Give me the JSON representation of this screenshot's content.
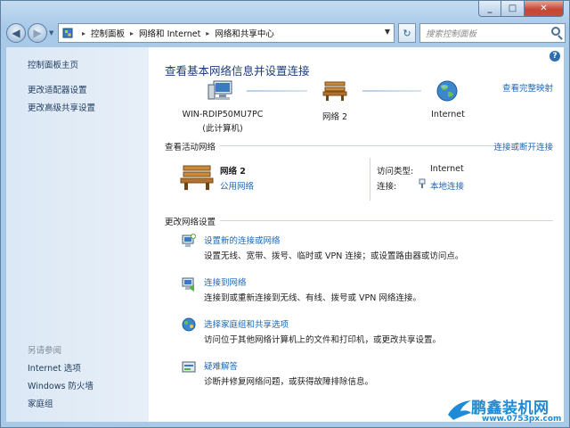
{
  "address": {
    "crumbs": [
      "控制面板",
      "网络和 Internet",
      "网络和共享中心"
    ]
  },
  "search": {
    "placeholder": "搜索控制面板"
  },
  "sidebar": {
    "links": [
      "控制面板主页",
      "更改适配器设置",
      "更改高级共享设置"
    ],
    "see_also_title": "另请参阅",
    "see_also": [
      "Internet 选项",
      "Windows 防火墙",
      "家庭组"
    ]
  },
  "main": {
    "title": "查看基本网络信息并设置连接",
    "full_map_link": "查看完整映射",
    "map": {
      "computer_name": "WIN-RDIP50MU7PC",
      "computer_sub": "(此计算机)",
      "network": "网络  2",
      "internet": "Internet"
    },
    "active": {
      "heading": "查看活动网络",
      "connect_link": "连接或断开连接",
      "name": "网络  2",
      "type": "公用网络",
      "access_label": "访问类型:",
      "access_value": "Internet",
      "conn_label": "连接:",
      "conn_value": "本地连接"
    },
    "change": {
      "heading": "更改网络设置",
      "tasks": [
        {
          "title": "设置新的连接或网络",
          "desc": "设置无线、宽带、拨号、临时或 VPN 连接；或设置路由器或访问点。"
        },
        {
          "title": "连接到网络",
          "desc": "连接到或重新连接到无线、有线、拨号或 VPN 网络连接。"
        },
        {
          "title": "选择家庭组和共享选项",
          "desc": "访问位于其他网络计算机上的文件和打印机，或更改共享设置。"
        },
        {
          "title": "疑难解答",
          "desc": "诊断并修复网络问题，或获得故障排除信息。"
        }
      ]
    }
  },
  "watermark": {
    "brand": "鹏鑫装机网",
    "url": "www.0753px.com"
  },
  "colors": {
    "link": "#1b67b8",
    "title": "#1b3c77",
    "sidebar": "#dbe8f5"
  }
}
